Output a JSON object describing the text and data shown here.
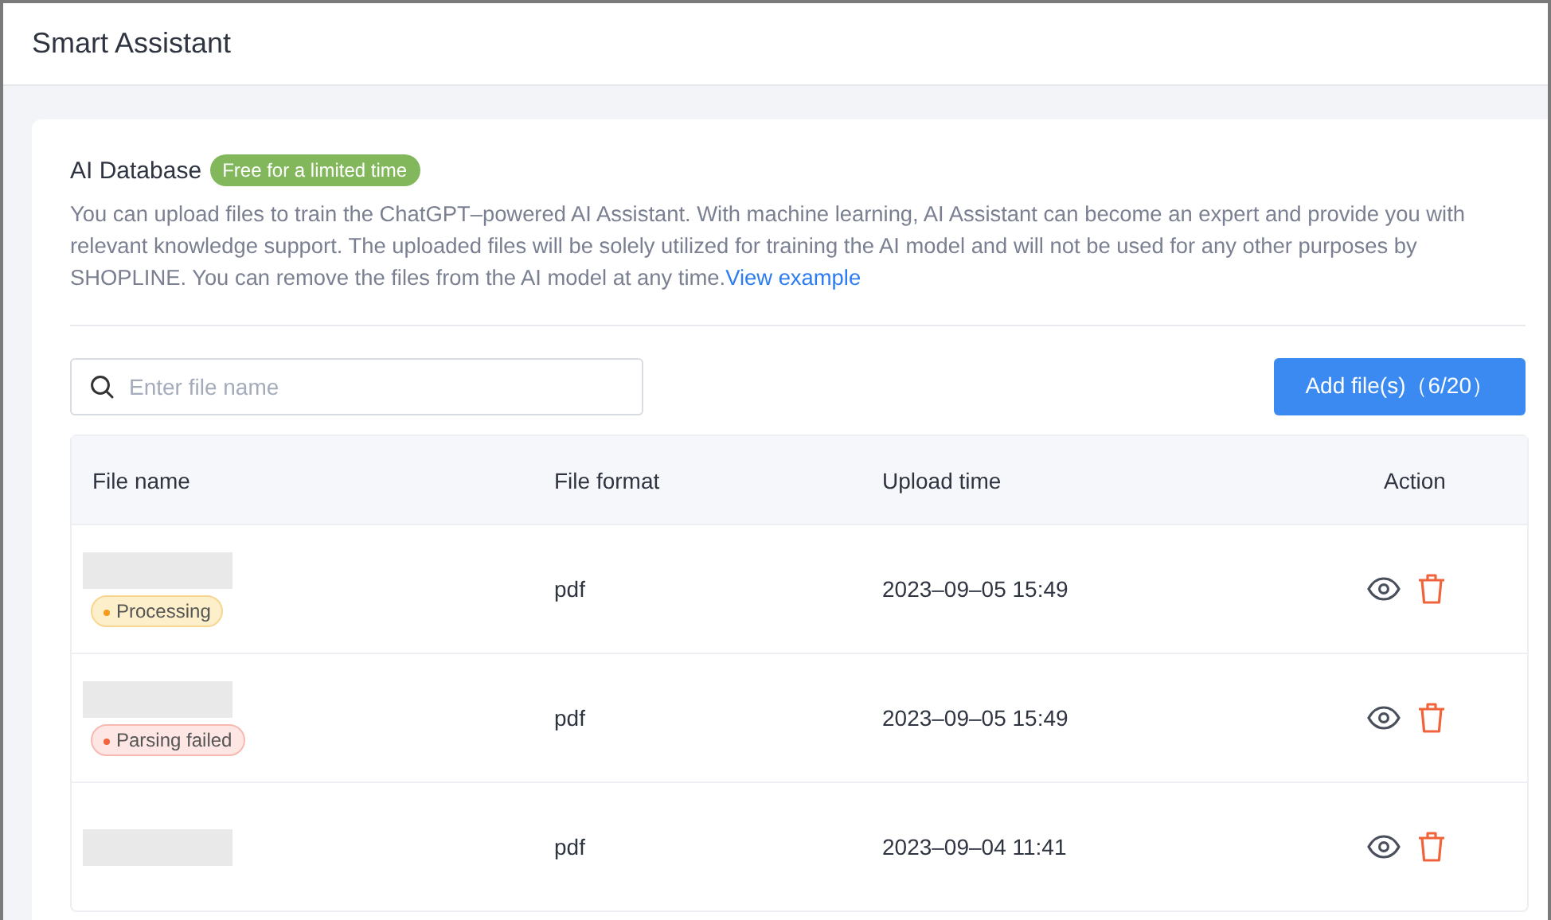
{
  "header": {
    "title": "Smart Assistant"
  },
  "section": {
    "title": "AI Database",
    "badge": "Free for a limited time",
    "description": "You can upload files to train the ChatGPT–powered AI Assistant. With machine learning, AI Assistant can become an expert and provide you with relevant knowledge support. The uploaded files will be solely utilized for training the AI model and will not be used for any other purposes by SHOPLINE. You can remove the files from the AI model at any time.",
    "link": "View example"
  },
  "search": {
    "placeholder": "Enter file name"
  },
  "add_button": "Add file(s)（6/20）",
  "table": {
    "columns": [
      "File name",
      "File format",
      "Upload time",
      "Action"
    ],
    "rows": [
      {
        "status": {
          "kind": "processing",
          "label": "Processing"
        },
        "format": "pdf",
        "time": "2023–09–05 15:49"
      },
      {
        "status": {
          "kind": "failed",
          "label": "Parsing failed"
        },
        "format": "pdf",
        "time": "2023–09–05 15:49"
      },
      {
        "format": "pdf",
        "time": "2023–09–04 11:41"
      }
    ]
  }
}
